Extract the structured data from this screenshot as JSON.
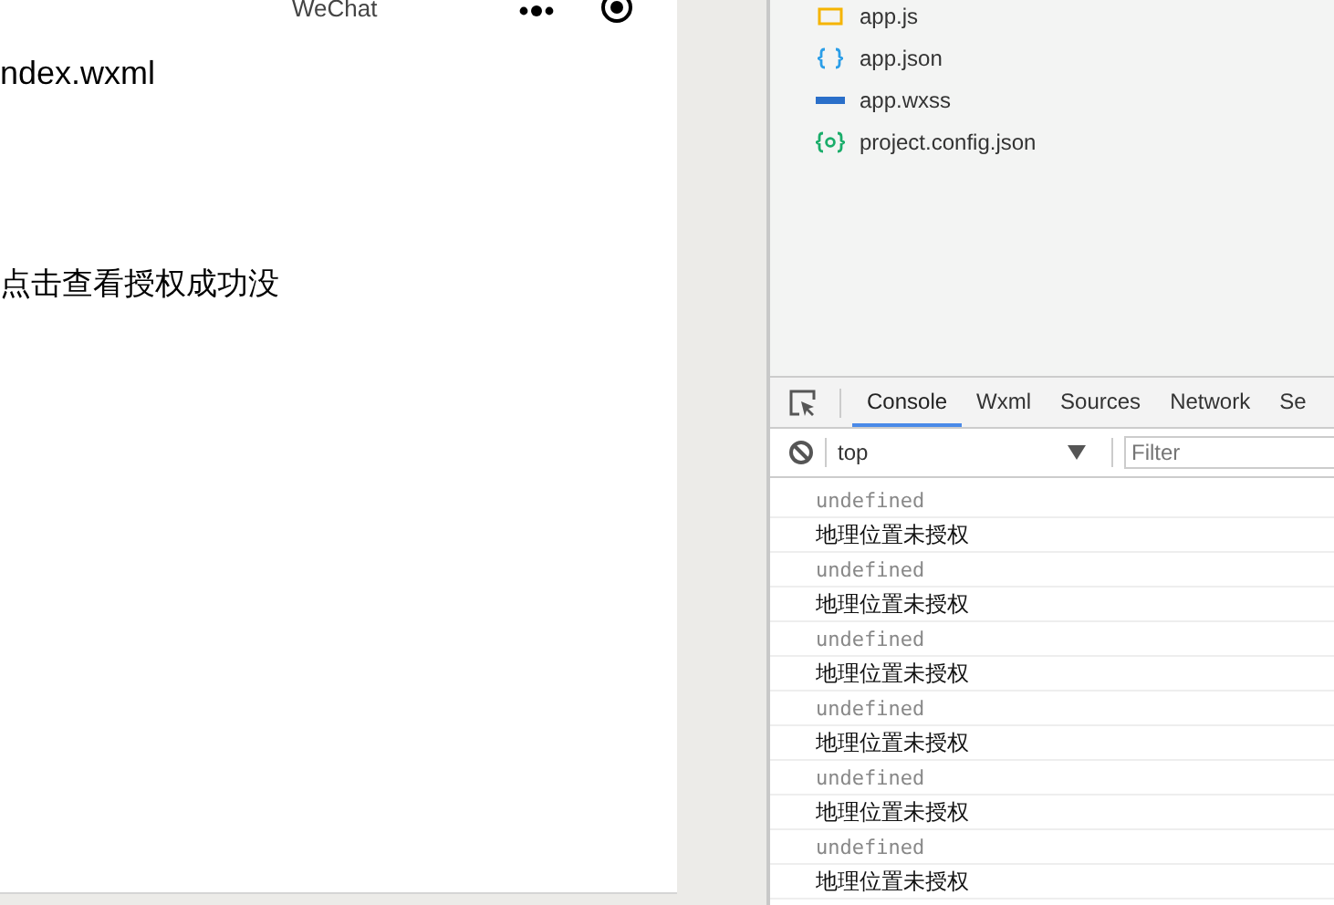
{
  "simulator": {
    "nav_title": "WeChat",
    "lines": [
      "ndex.wxml",
      "点击查看授权成功没"
    ]
  },
  "file_tree": {
    "items": [
      {
        "name": "app.js",
        "kind": "js"
      },
      {
        "name": "app.json",
        "kind": "json"
      },
      {
        "name": "app.wxss",
        "kind": "wxss"
      },
      {
        "name": "project.config.json",
        "kind": "config"
      }
    ]
  },
  "devtools": {
    "tabs": [
      {
        "label": "Console",
        "selected": true
      },
      {
        "label": "Wxml",
        "selected": false
      },
      {
        "label": "Sources",
        "selected": false
      },
      {
        "label": "Network",
        "selected": false
      },
      {
        "label": "Se",
        "selected": false
      }
    ],
    "context": "top",
    "filter": {
      "placeholder": "Filter"
    },
    "logs": [
      {
        "text": "undefined",
        "kind": "value"
      },
      {
        "text": "地理位置未授权",
        "kind": "log"
      },
      {
        "text": "undefined",
        "kind": "value"
      },
      {
        "text": "地理位置未授权",
        "kind": "log"
      },
      {
        "text": "undefined",
        "kind": "value"
      },
      {
        "text": "地理位置未授权",
        "kind": "log"
      },
      {
        "text": "undefined",
        "kind": "value"
      },
      {
        "text": "地理位置未授权",
        "kind": "log"
      },
      {
        "text": "undefined",
        "kind": "value"
      },
      {
        "text": "地理位置未授权",
        "kind": "log"
      },
      {
        "text": "undefined",
        "kind": "value"
      },
      {
        "text": "地理位置未授权",
        "kind": "log"
      }
    ]
  }
}
